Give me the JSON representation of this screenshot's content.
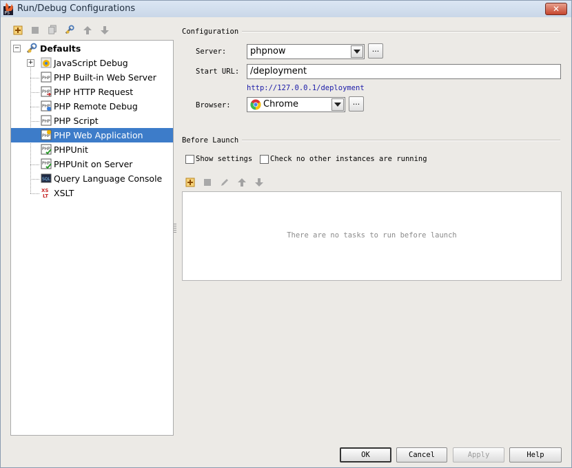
{
  "window": {
    "title": "Run/Debug Configurations",
    "close_glyph": "✕"
  },
  "toolbar": {
    "icons": [
      "add-icon",
      "remove-icon",
      "copy-icon",
      "edit-defaults-icon",
      "move-up-icon",
      "move-down-icon"
    ]
  },
  "tree": {
    "root": {
      "label": "Defaults",
      "expander": "−"
    },
    "items": [
      {
        "label": "JavaScript Debug",
        "expander": "+"
      },
      {
        "label": "PHP Built-in Web Server"
      },
      {
        "label": "PHP HTTP Request"
      },
      {
        "label": "PHP Remote Debug"
      },
      {
        "label": "PHP Script"
      },
      {
        "label": "PHP Web Application",
        "selected": true
      },
      {
        "label": "PHPUnit"
      },
      {
        "label": "PHPUnit on Server"
      },
      {
        "label": "Query Language Console"
      },
      {
        "label": "XSLT"
      }
    ]
  },
  "configuration": {
    "section_title": "Configuration",
    "server": {
      "label": "Server:",
      "value": "phpnow",
      "more": "..."
    },
    "start_url": {
      "label": "Start URL:",
      "value": "/deployment"
    },
    "resolved_url": "http://127.0.0.1/deployment",
    "browser": {
      "label": "Browser:",
      "value": "Chrome",
      "more": "..."
    }
  },
  "before_launch": {
    "section_title": "Before Launch",
    "show_settings": {
      "label": "Show settings",
      "checked": false
    },
    "check_instances": {
      "label": "Check no other instances are running",
      "checked": false
    },
    "toolbar_icons": [
      "add-icon",
      "remove-icon",
      "edit-icon",
      "move-up-icon",
      "move-down-icon"
    ],
    "empty_text": "There are no tasks to run before launch"
  },
  "buttons": {
    "ok": "OK",
    "cancel": "Cancel",
    "apply": "Apply",
    "help": "Help"
  },
  "colors": {
    "selection": "#3d7cc9",
    "link": "#1a1aa8",
    "background": "#eceae6"
  }
}
